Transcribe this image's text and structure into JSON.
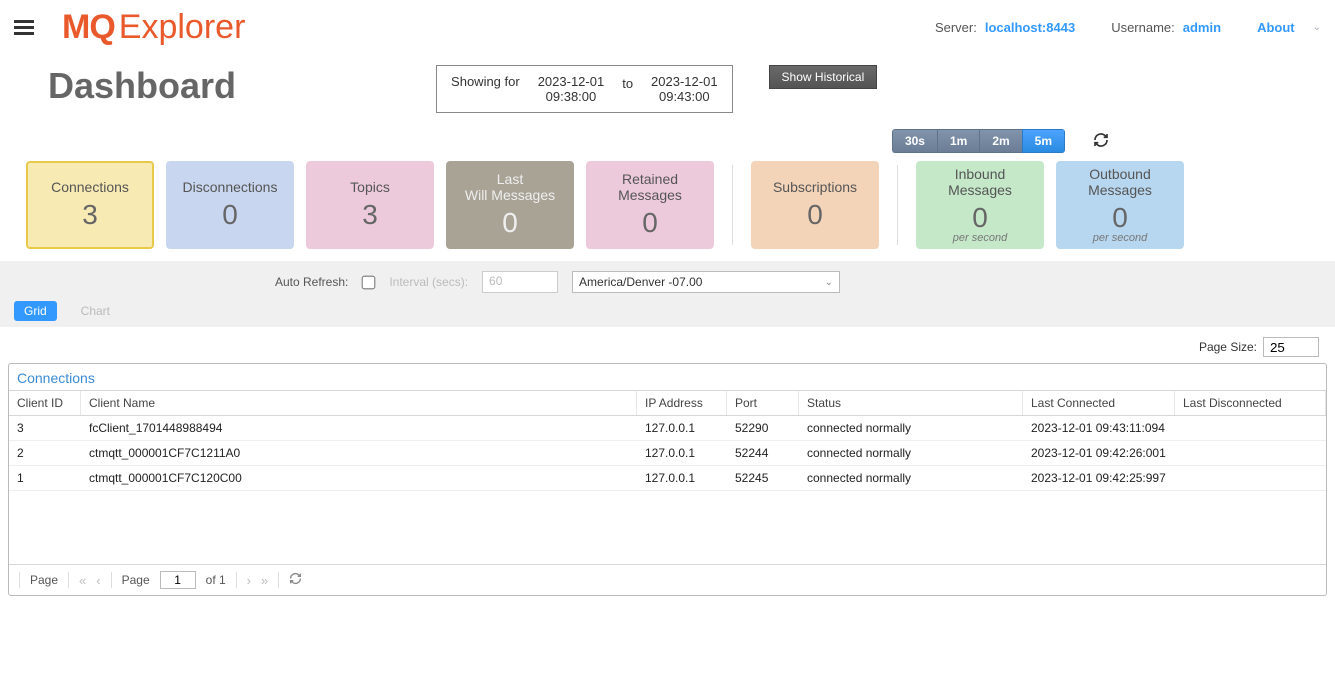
{
  "header": {
    "server_label": "Server:",
    "server_value": "localhost:8443",
    "user_label": "Username:",
    "user_value": "admin",
    "about": "About"
  },
  "dashboard": {
    "title": "Dashboard",
    "showing_for": "Showing for",
    "from_date": "2023-12-01",
    "from_time": "09:38:00",
    "to_label": "to",
    "to_date": "2023-12-01",
    "to_time": "09:43:00",
    "show_historical": "Show Historical"
  },
  "intervals": {
    "b30s": "30s",
    "b1m": "1m",
    "b2m": "2m",
    "b5m": "5m"
  },
  "cards": {
    "connections": {
      "title": "Connections",
      "value": "3"
    },
    "disconnections": {
      "title": "Disconnections",
      "value": "0"
    },
    "topics": {
      "title": "Topics",
      "value": "3"
    },
    "lwt": {
      "title1": "Last",
      "title2": "Will Messages",
      "value": "0"
    },
    "retained": {
      "title1": "Retained",
      "title2": "Messages",
      "value": "0"
    },
    "subs": {
      "title": "Subscriptions",
      "value": "0"
    },
    "inbound": {
      "title1": "Inbound",
      "title2": "Messages",
      "value": "0",
      "ps": "per second"
    },
    "outbound": {
      "title1": "Outbound",
      "title2": "Messages",
      "value": "0",
      "ps": "per second"
    }
  },
  "filters": {
    "autorefresh": "Auto Refresh:",
    "interval_label": "Interval (secs):",
    "interval_value": "60",
    "timezone": "America/Denver -07.00",
    "grid": "Grid",
    "chart": "Chart"
  },
  "pagesize": {
    "label": "Page Size:",
    "value": "25"
  },
  "grid": {
    "title": "Connections",
    "cols": {
      "id": "Client ID",
      "name": "Client Name",
      "ip": "IP Address",
      "port": "Port",
      "status": "Status",
      "lastc": "Last Connected",
      "lastd": "Last Disconnected"
    },
    "rows": [
      {
        "id": "3",
        "name": "fcClient_1701448988494",
        "ip": "127.0.0.1",
        "port": "52290",
        "status": "connected normally",
        "lastc": "2023-12-01 09:43:11:094",
        "lastd": ""
      },
      {
        "id": "2",
        "name": "ctmqtt_000001CF7C1211A0",
        "ip": "127.0.0.1",
        "port": "52244",
        "status": "connected normally",
        "lastc": "2023-12-01 09:42:26:001",
        "lastd": ""
      },
      {
        "id": "1",
        "name": "ctmqtt_000001CF7C120C00",
        "ip": "127.0.0.1",
        "port": "52245",
        "status": "connected normally",
        "lastc": "2023-12-01 09:42:25:997",
        "lastd": ""
      }
    ]
  },
  "pager": {
    "page_lbl": "Page",
    "page_lbl2": "Page",
    "cur": "1",
    "of": "of 1"
  }
}
